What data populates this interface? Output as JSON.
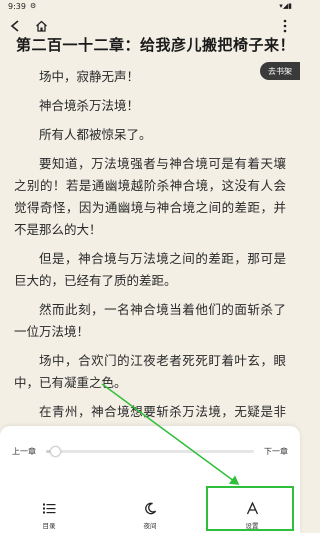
{
  "status_bar": {
    "time": "9:39"
  },
  "reader": {
    "chapter_title": "第二百一十二章：给我彦儿搬把椅子来！",
    "shelf_button": "去书架",
    "paragraphs": [
      "场中，寂静无声！",
      "神合境杀万法境！",
      "所有人都被惊呆了。",
      "要知道，万法境强者与神合境可是有着天壤之别的！若是通幽境越阶杀神合境，这没有人会觉得奇怪，因为通幽境与神合境之间的差距，并不是那么的大！",
      "但是，神合境与万法境之间的差距，那可是巨大的，已经有了质的差距。",
      "然而此刻，一名神合境当着他们的面斩杀了一位万法境！",
      "场中，合欢门的江夜老者死死盯着叶玄，眼中，已有凝重之色。",
      "在青州，神合境想要斩杀万法境，无疑是非常难的事情，或者说基本没有。但是在遥远的中土神州，神合境斩杀万法境，却不是什么难事"
    ]
  },
  "panel": {
    "prev_chapter": "上一章",
    "next_chapter": "下一章",
    "progress_fraction": 0.03,
    "tools": {
      "toc": "目录",
      "night": "夜间",
      "settings": "设置"
    }
  },
  "colors": {
    "highlight": "#2fbf3a"
  }
}
